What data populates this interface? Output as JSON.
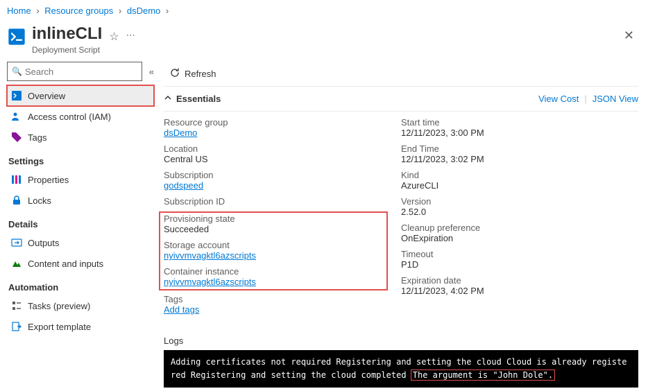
{
  "breadcrumb": {
    "home": "Home",
    "resourceGroups": "Resource groups",
    "rg": "dsDemo"
  },
  "header": {
    "title": "inlineCLI",
    "subtitle": "Deployment Script"
  },
  "sidebar": {
    "searchPlaceholder": "Search",
    "items": {
      "overview": "Overview",
      "accessControl": "Access control (IAM)",
      "tags": "Tags"
    },
    "settingsHeader": "Settings",
    "settings": {
      "properties": "Properties",
      "locks": "Locks"
    },
    "detailsHeader": "Details",
    "details": {
      "outputs": "Outputs",
      "contentInputs": "Content and inputs"
    },
    "automationHeader": "Automation",
    "automation": {
      "tasks": "Tasks (preview)",
      "exportTemplate": "Export template"
    }
  },
  "toolbar": {
    "refresh": "Refresh"
  },
  "essentials": {
    "header": "Essentials",
    "viewCost": "View Cost",
    "jsonView": "JSON View",
    "left": {
      "resourceGroupLabel": "Resource group",
      "resourceGroup": "dsDemo",
      "locationLabel": "Location",
      "location": "Central US",
      "subscriptionLabel": "Subscription",
      "subscription": "godspeed",
      "subscriptionIdLabel": "Subscription ID",
      "subscriptionId": "",
      "provisioningLabel": "Provisioning state",
      "provisioning": "Succeeded",
      "storageLabel": "Storage account",
      "storage": "nyivvmvagktl6azscripts",
      "containerLabel": "Container instance",
      "container": "nyivvmvagktl6azscripts",
      "tagsLabel": "Tags",
      "tags": "Add tags"
    },
    "right": {
      "startLabel": "Start time",
      "start": "12/11/2023, 3:00 PM",
      "endLabel": "End Time",
      "end": "12/11/2023, 3:02 PM",
      "kindLabel": "Kind",
      "kind": "AzureCLI",
      "versionLabel": "Version",
      "version": "2.52.0",
      "cleanupLabel": "Cleanup preference",
      "cleanup": "OnExpiration",
      "timeoutLabel": "Timeout",
      "timeout": "P1D",
      "expirationLabel": "Expiration date",
      "expiration": "12/11/2023, 4:02 PM"
    }
  },
  "logs": {
    "header": "Logs",
    "pre": "Adding certificates not required Registering and setting the cloud Cloud is already registered Registering and setting the cloud completed ",
    "highlight": "The argument is \"John Dole\"."
  }
}
